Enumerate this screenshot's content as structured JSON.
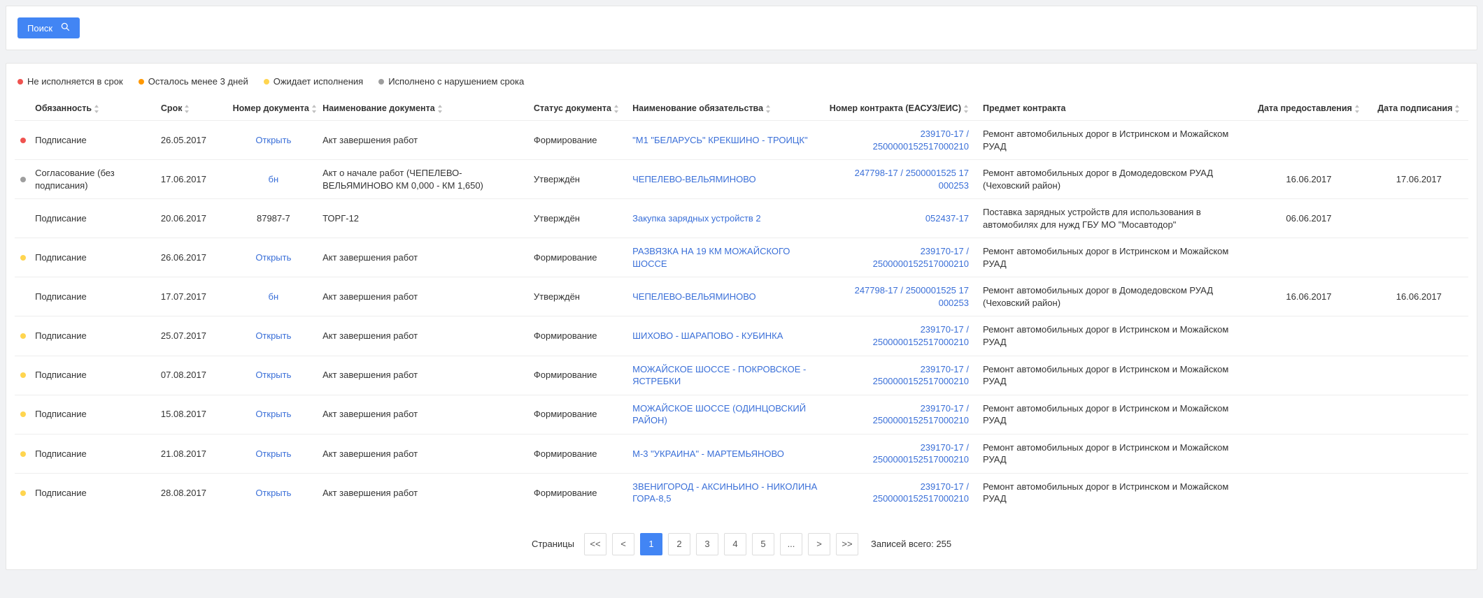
{
  "search": {
    "button_label": "Поиск"
  },
  "legend": [
    {
      "color": "red",
      "label": "Не исполняется в срок"
    },
    {
      "color": "orange",
      "label": "Осталось менее 3 дней"
    },
    {
      "color": "yellow",
      "label": "Ожидает исполнения"
    },
    {
      "color": "grey",
      "label": "Исполнено с нарушением срока"
    }
  ],
  "columns": {
    "obligation": "Обязанность",
    "deadline": "Срок",
    "doc_number": "Номер документа",
    "doc_name": "Наименование документа",
    "doc_status": "Статус документа",
    "obligation_name": "Наименование обязательства",
    "contract_number": "Номер контракта (ЕАСУЗ/ЕИС)",
    "contract_subject": "Предмет контракта",
    "provision_date": "Дата предоставления",
    "sign_date": "Дата подписания"
  },
  "rows": [
    {
      "status": "red",
      "obligation": "Подписание",
      "deadline": "26.05.2017",
      "doc_number": "Открыть",
      "doc_number_is_link": true,
      "doc_name": "Акт завершения работ",
      "doc_status": "Формирование",
      "obligation_name": "\"М1 \"БЕЛАРУСЬ\" КРЕКШИНО - ТРОИЦК\"",
      "contract_number": "239170-17 / 2500000152517000210",
      "contract_subject": "Ремонт автомобильных дорог в Истринском и Можайском РУАД",
      "provision_date": "",
      "sign_date": ""
    },
    {
      "status": "grey",
      "obligation": "Согласование (без подписания)",
      "deadline": "17.06.2017",
      "doc_number": "бн",
      "doc_number_is_link": true,
      "doc_name": "Акт о начале работ (ЧЕПЕЛЕВО-ВЕЛЬЯМИНОВО КМ 0,000 - КМ 1,650)",
      "doc_status": "Утверждён",
      "obligation_name": "ЧЕПЕЛЕВО-ВЕЛЬЯМИНОВО",
      "contract_number": "247798-17 / 2500001525 17 000253",
      "contract_subject": "Ремонт автомобильных дорог в Домодедовском РУАД (Чеховский район)",
      "provision_date": "16.06.2017",
      "sign_date": "17.06.2017"
    },
    {
      "status": "",
      "obligation": "Подписание",
      "deadline": "20.06.2017",
      "doc_number": "87987-7",
      "doc_number_is_link": false,
      "doc_name": "ТОРГ-12",
      "doc_status": "Утверждён",
      "obligation_name": "Закупка зарядных устройств 2",
      "contract_number": "052437-17",
      "contract_subject": "Поставка зарядных устройств для использования в автомобилях для нужд ГБУ МО \"Мосавтодор\"",
      "provision_date": "06.06.2017",
      "sign_date": ""
    },
    {
      "status": "yellow",
      "obligation": "Подписание",
      "deadline": "26.06.2017",
      "doc_number": "Открыть",
      "doc_number_is_link": true,
      "doc_name": "Акт завершения работ",
      "doc_status": "Формирование",
      "obligation_name": "РАЗВЯЗКА НА 19 КМ МОЖАЙСКОГО ШОССЕ",
      "contract_number": "239170-17 / 2500000152517000210",
      "contract_subject": "Ремонт автомобильных дорог в Истринском и Можайском РУАД",
      "provision_date": "",
      "sign_date": ""
    },
    {
      "status": "",
      "obligation": "Подписание",
      "deadline": "17.07.2017",
      "doc_number": "бн",
      "doc_number_is_link": true,
      "doc_name": "Акт завершения работ",
      "doc_status": "Утверждён",
      "obligation_name": "ЧЕПЕЛЕВО-ВЕЛЬЯМИНОВО",
      "contract_number": "247798-17 / 2500001525 17 000253",
      "contract_subject": "Ремонт автомобильных дорог в Домодедовском РУАД (Чеховский район)",
      "provision_date": "16.06.2017",
      "sign_date": "16.06.2017"
    },
    {
      "status": "yellow",
      "obligation": "Подписание",
      "deadline": "25.07.2017",
      "doc_number": "Открыть",
      "doc_number_is_link": true,
      "doc_name": "Акт завершения работ",
      "doc_status": "Формирование",
      "obligation_name": "ШИХОВО - ШАРАПОВО - КУБИНКА",
      "contract_number": "239170-17 / 2500000152517000210",
      "contract_subject": "Ремонт автомобильных дорог в Истринском и Можайском РУАД",
      "provision_date": "",
      "sign_date": ""
    },
    {
      "status": "yellow",
      "obligation": "Подписание",
      "deadline": "07.08.2017",
      "doc_number": "Открыть",
      "doc_number_is_link": true,
      "doc_name": "Акт завершения работ",
      "doc_status": "Формирование",
      "obligation_name": "МОЖАЙСКОЕ ШОССЕ - ПОКРОВСКОЕ - ЯСТРЕБКИ",
      "contract_number": "239170-17 / 2500000152517000210",
      "contract_subject": "Ремонт автомобильных дорог в Истринском и Можайском РУАД",
      "provision_date": "",
      "sign_date": ""
    },
    {
      "status": "yellow",
      "obligation": "Подписание",
      "deadline": "15.08.2017",
      "doc_number": "Открыть",
      "doc_number_is_link": true,
      "doc_name": "Акт завершения работ",
      "doc_status": "Формирование",
      "obligation_name": "МОЖАЙСКОЕ ШОССЕ (ОДИНЦОВСКИЙ РАЙОН)",
      "contract_number": "239170-17 / 2500000152517000210",
      "contract_subject": "Ремонт автомобильных дорог в Истринском и Можайском РУАД",
      "provision_date": "",
      "sign_date": ""
    },
    {
      "status": "yellow",
      "obligation": "Подписание",
      "deadline": "21.08.2017",
      "doc_number": "Открыть",
      "doc_number_is_link": true,
      "doc_name": "Акт завершения работ",
      "doc_status": "Формирование",
      "obligation_name": "М-3 \"УКРАИНА\" - МАРТЕМЬЯНОВО",
      "contract_number": "239170-17 / 2500000152517000210",
      "contract_subject": "Ремонт автомобильных дорог в Истринском и Можайском РУАД",
      "provision_date": "",
      "sign_date": ""
    },
    {
      "status": "yellow",
      "obligation": "Подписание",
      "deadline": "28.08.2017",
      "doc_number": "Открыть",
      "doc_number_is_link": true,
      "doc_name": "Акт завершения работ",
      "doc_status": "Формирование",
      "obligation_name": "ЗВЕНИГОРОД - АКСИНЬИНО - НИКОЛИНА ГОРА-8,5",
      "contract_number": "239170-17 / 2500000152517000210",
      "contract_subject": "Ремонт автомобильных дорог в Истринском и Можайском РУАД",
      "provision_date": "",
      "sign_date": ""
    }
  ],
  "pagination": {
    "label": "Страницы",
    "first": "<<",
    "prev": "<",
    "pages": [
      "1",
      "2",
      "3",
      "4",
      "5",
      "..."
    ],
    "next": ">",
    "last": ">>",
    "active": "1",
    "total_label": "Записей всего: 255"
  }
}
